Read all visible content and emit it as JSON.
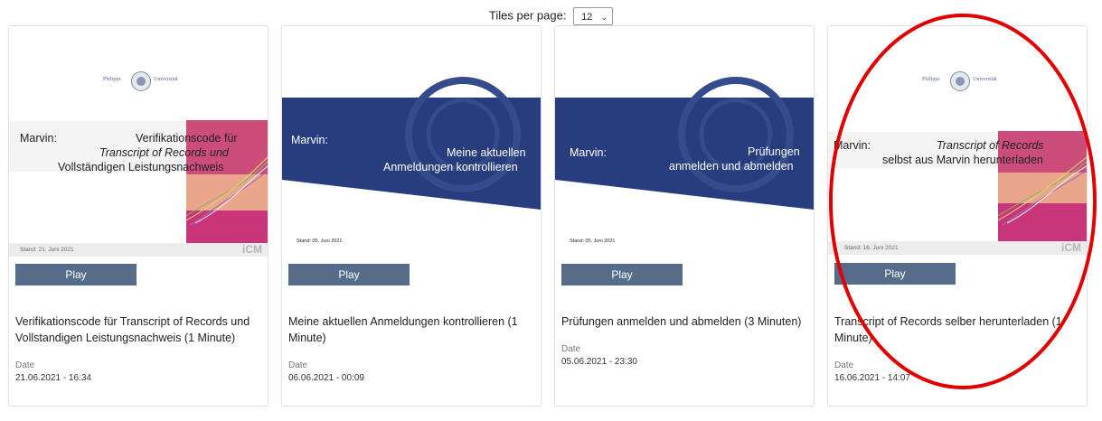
{
  "pagination": {
    "tiles_per_page_label": "Tiles per page:",
    "tiles_per_page_value": "12"
  },
  "colors": {
    "play_button": "#556c8b",
    "banner_blue": "#283d7e",
    "accent_pink": "#cc4d7a",
    "highlight_ellipse": "#e00000"
  },
  "tiles": [
    {
      "thumbnail": {
        "logo_left": "Philipps",
        "logo_right": "Universität",
        "prefix": "Marvin:",
        "line1": "Verifikationscode für",
        "line2": "Transcript of Records und",
        "line3": "Vollständigen Leistungsnachweis",
        "stand": "Stand: 21. Juni 2021",
        "brand": "iCM"
      },
      "play_label": "Play",
      "title": "Verifikationscode für Transcript of Records und Vollstandigen Leistungsnachweis (1 Minute)",
      "date_label": "Date",
      "date_value": "21.06.2021 - 16:34"
    },
    {
      "thumbnail": {
        "prefix": "Marvin:",
        "line1": "Meine aktuellen",
        "line2": "Anmeldungen kontrollieren",
        "stand": "Stand: 05. Juni 2021"
      },
      "play_label": "Play",
      "title": "Meine aktuellen Anmeldungen kontrollieren (1 Minute)",
      "date_label": "Date",
      "date_value": "06.06.2021 - 00:09"
    },
    {
      "thumbnail": {
        "prefix": "Marvin:",
        "line1": "Prüfungen",
        "line2": "anmelden und abmelden",
        "stand": "Stand: 05. Juni 2021"
      },
      "play_label": "Play",
      "title": "Prüfungen anmelden und abmelden (3 Minuten)",
      "date_label": "Date",
      "date_value": "05.06.2021 - 23:30"
    },
    {
      "thumbnail": {
        "logo_left": "Philipps",
        "logo_right": "Universität",
        "prefix": "Marvin:",
        "line1": "Transcript of Records",
        "line2": "selbst aus Marvin herunterladen",
        "stand": "Stand: 16. Juni 2021",
        "brand": "iCM"
      },
      "play_label": "Play",
      "title": "Transcript of Records selber herunterladen (1 Minute)",
      "date_label": "Date",
      "date_value": "16.06.2021 - 14:07"
    }
  ]
}
